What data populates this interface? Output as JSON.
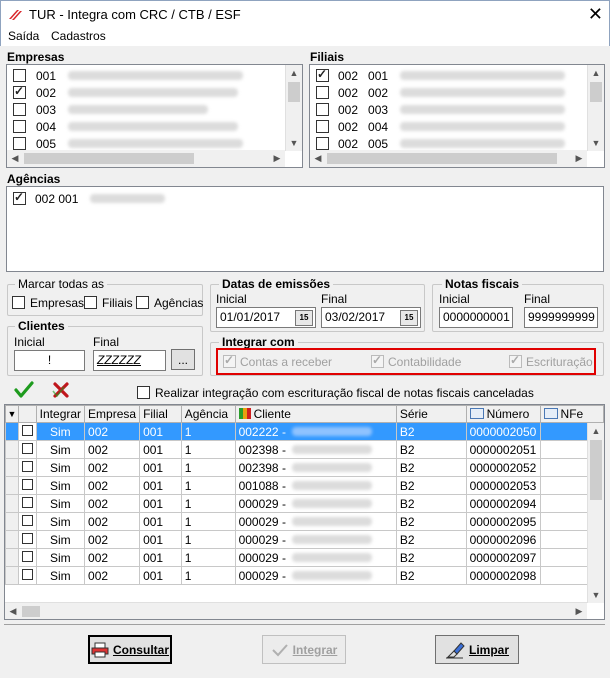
{
  "window": {
    "title": "TUR - Integra com CRC / CTB / ESF",
    "close_glyph": "✕"
  },
  "menu": {
    "items": [
      "Saída",
      "Cadastros"
    ]
  },
  "empresas": {
    "label": "Empresas",
    "items": [
      {
        "code": "001",
        "checked": false
      },
      {
        "code": "002",
        "checked": true
      },
      {
        "code": "003",
        "checked": false
      },
      {
        "code": "004",
        "checked": false
      },
      {
        "code": "005",
        "checked": false
      }
    ]
  },
  "filiais": {
    "label": "Filiais",
    "items": [
      {
        "empresa": "002",
        "filial": "001",
        "checked": true
      },
      {
        "empresa": "002",
        "filial": "002",
        "checked": false
      },
      {
        "empresa": "002",
        "filial": "003",
        "checked": false
      },
      {
        "empresa": "002",
        "filial": "004",
        "checked": false
      },
      {
        "empresa": "002",
        "filial": "005",
        "checked": false
      }
    ]
  },
  "agencias": {
    "label": "Agências",
    "items": [
      {
        "code": "002 001",
        "checked": true
      }
    ]
  },
  "marcar_todas": {
    "label": "Marcar todas as",
    "empresas": "Empresas",
    "filiais": "Filiais",
    "agencias": "Agências"
  },
  "clientes": {
    "label": "Clientes",
    "inicial_label": "Inicial",
    "final_label": "Final",
    "inicial_value": "!",
    "final_value": "ZZZZZZ",
    "lookup_label": "..."
  },
  "datas": {
    "label": "Datas de emissões",
    "inicial_label": "Inicial",
    "final_label": "Final",
    "inicial_value": "01/01/2017",
    "final_value": "03/02/2017",
    "cal_label": "15"
  },
  "notas": {
    "label": "Notas fiscais",
    "inicial_label": "Inicial",
    "final_label": "Final",
    "inicial_value": "0000000001",
    "final_value": "9999999999"
  },
  "integrar_com": {
    "label": "Integrar com",
    "options": [
      {
        "label": "Contas a receber",
        "checked": true
      },
      {
        "label": "Contabilidade",
        "checked": true
      },
      {
        "label": "Escrituração",
        "checked": true
      }
    ],
    "highlight_color": "#e00000"
  },
  "actions": {
    "canceladas_label": "Realizar integração com escrituração fiscal de notas fiscais canceladas"
  },
  "grid": {
    "columns": [
      "Integrar",
      "Empresa",
      "Filial",
      "Agência",
      "Cliente",
      "Série",
      "Número",
      "NFe"
    ],
    "rows": [
      {
        "integrar": "Sim",
        "empresa": "002",
        "filial": "001",
        "agencia": "1",
        "cliente": "002222 -",
        "serie": "B2",
        "numero": "0000002050",
        "nfe": ""
      },
      {
        "integrar": "Sim",
        "empresa": "002",
        "filial": "001",
        "agencia": "1",
        "cliente": "002398 -",
        "serie": "B2",
        "numero": "0000002051",
        "nfe": ""
      },
      {
        "integrar": "Sim",
        "empresa": "002",
        "filial": "001",
        "agencia": "1",
        "cliente": "002398 -",
        "serie": "B2",
        "numero": "0000002052",
        "nfe": ""
      },
      {
        "integrar": "Sim",
        "empresa": "002",
        "filial": "001",
        "agencia": "1",
        "cliente": "001088 -",
        "serie": "B2",
        "numero": "0000002053",
        "nfe": ""
      },
      {
        "integrar": "Sim",
        "empresa": "002",
        "filial": "001",
        "agencia": "1",
        "cliente": "000029 -",
        "serie": "B2",
        "numero": "0000002094",
        "nfe": ""
      },
      {
        "integrar": "Sim",
        "empresa": "002",
        "filial": "001",
        "agencia": "1",
        "cliente": "000029 -",
        "serie": "B2",
        "numero": "0000002095",
        "nfe": ""
      },
      {
        "integrar": "Sim",
        "empresa": "002",
        "filial": "001",
        "agencia": "1",
        "cliente": "000029 -",
        "serie": "B2",
        "numero": "0000002096",
        "nfe": ""
      },
      {
        "integrar": "Sim",
        "empresa": "002",
        "filial": "001",
        "agencia": "1",
        "cliente": "000029 -",
        "serie": "B2",
        "numero": "0000002097",
        "nfe": ""
      },
      {
        "integrar": "Sim",
        "empresa": "002",
        "filial": "001",
        "agencia": "1",
        "cliente": "000029 -",
        "serie": "B2",
        "numero": "0000002098",
        "nfe": ""
      }
    ]
  },
  "buttons": {
    "consultar": "Consultar",
    "integrar": "Integrar",
    "limpar": "Limpar"
  }
}
